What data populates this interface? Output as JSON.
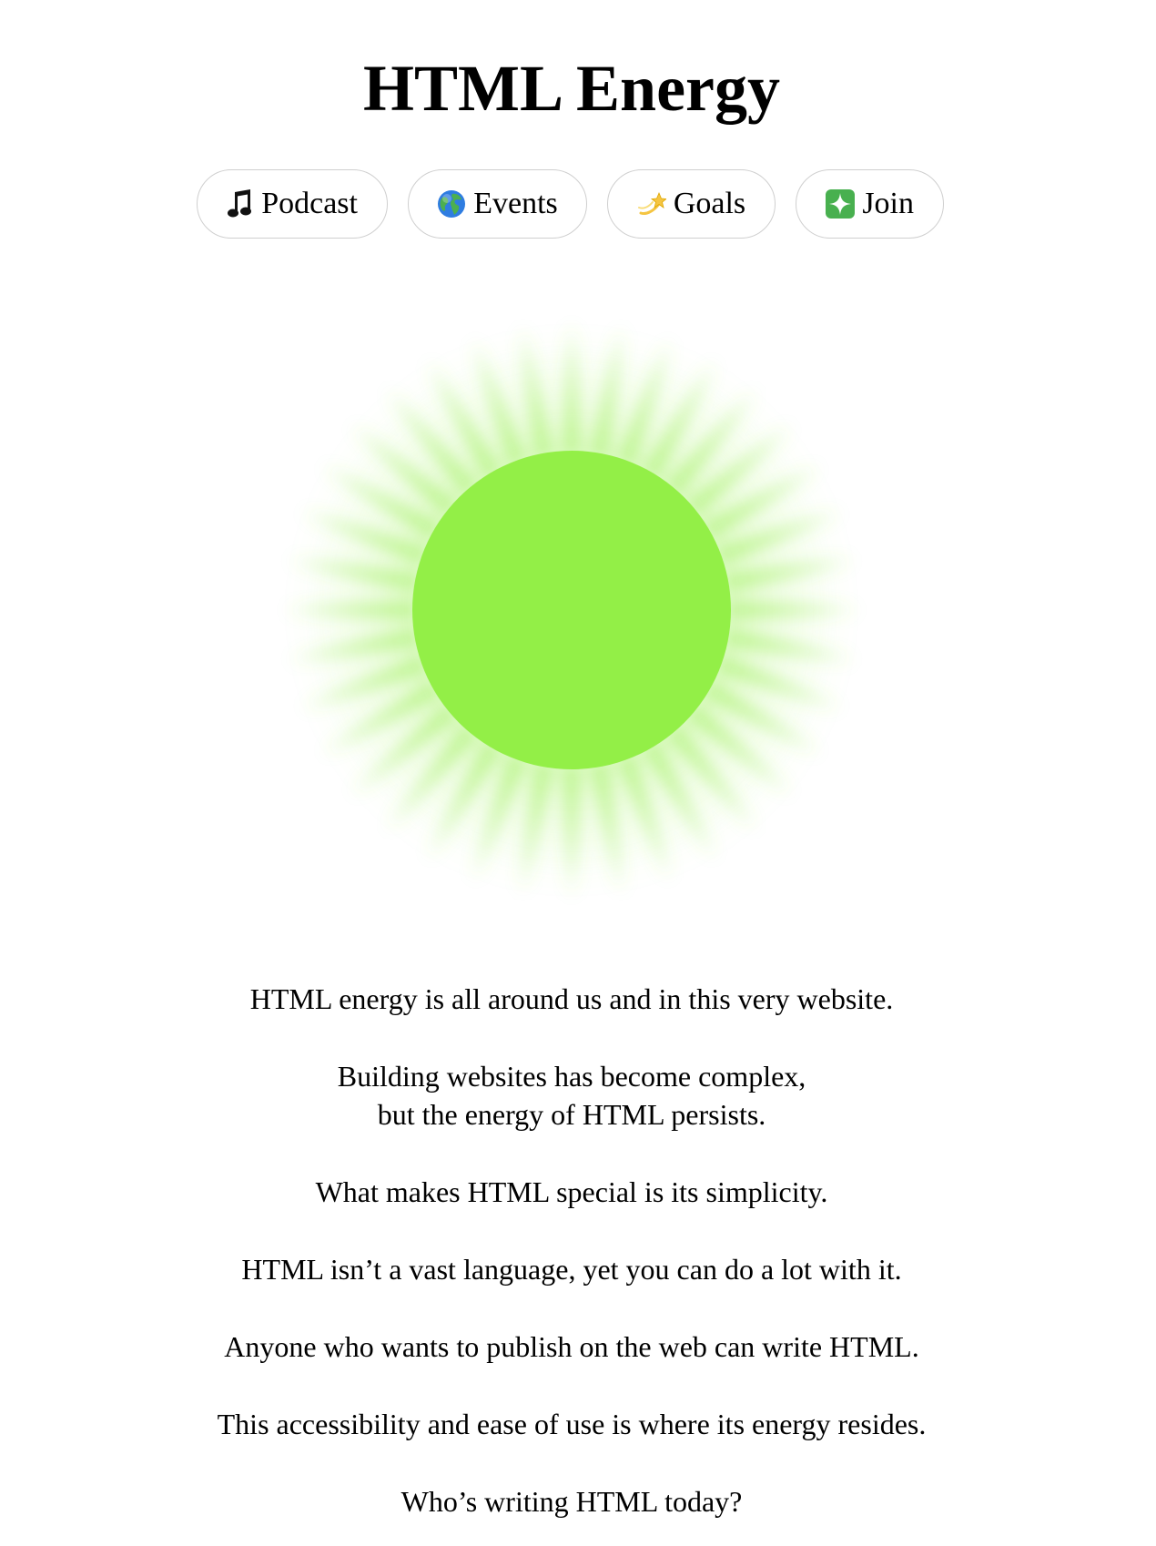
{
  "title": "HTML Energy",
  "nav": [
    {
      "label": "Podcast",
      "icon": "music-note-icon"
    },
    {
      "label": "Events",
      "icon": "globe-icon"
    },
    {
      "label": "Goals",
      "icon": "dizzy-star-icon"
    },
    {
      "label": "Join",
      "icon": "sparkle-icon"
    }
  ],
  "hero": {
    "icon": "glowing-green-sun",
    "color": "#93ef47"
  },
  "paragraphs": [
    "HTML energy is all around us and in this very website.",
    "Building websites has become complex,",
    "but the energy of HTML persists.",
    "What makes HTML special is its simplicity.",
    "HTML isn’t a vast language, yet you can do a lot with it.",
    "Anyone who wants to publish on the web can write HTML.",
    "This accessibility and ease of use is where its energy resides.",
    "Who’s writing HTML today?"
  ]
}
